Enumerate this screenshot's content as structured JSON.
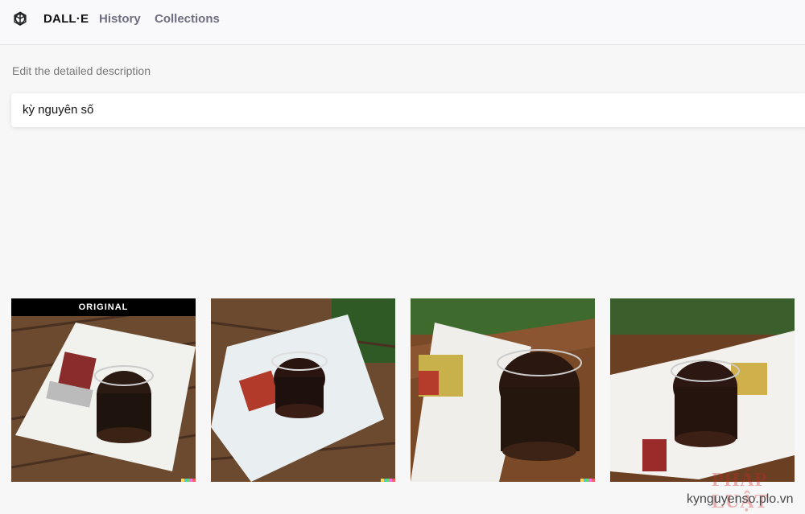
{
  "nav": {
    "logo_icon": "openai-logo-icon",
    "brand": "DALL·E",
    "history": "History",
    "collections": "Collections"
  },
  "prompt": {
    "label": "Edit the detailed description",
    "value": "kỳ nguyên số"
  },
  "results": {
    "original_badge": "ORIGINAL",
    "images": [
      {
        "name": "original-image",
        "description_icon": "coffee-glass-on-book-image"
      },
      {
        "name": "variation-1",
        "description_icon": "coffee-glass-on-magazine-image"
      },
      {
        "name": "variation-2",
        "description_icon": "coffee-glass-on-open-book-image"
      },
      {
        "name": "variation-3",
        "description_icon": "coffee-glass-on-open-book-image"
      }
    ],
    "signature_colors": [
      "#ffd84d",
      "#42c2f5",
      "#59e06b",
      "#f56ee0",
      "#ff5c5c"
    ]
  },
  "watermark": {
    "logo": "PHÁP LUẬT",
    "url": "kynguyenso.plo.vn"
  }
}
